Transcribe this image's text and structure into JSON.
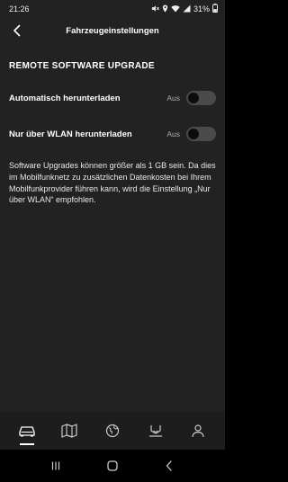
{
  "status_bar": {
    "time": "21:26",
    "battery": "31%",
    "icons": [
      "mute-icon",
      "location-icon",
      "wifi-icon",
      "signal-icon",
      "battery-icon"
    ]
  },
  "header": {
    "title": "Fahrzeugeinstellungen",
    "back_icon": "chevron-left-icon"
  },
  "section": {
    "title": "REMOTE SOFTWARE UPGRADE"
  },
  "settings": [
    {
      "label": "Automatisch herunterladen",
      "state": "Aus",
      "enabled": false
    },
    {
      "label": "Nur über WLAN herunterladen",
      "state": "Aus",
      "enabled": false
    }
  ],
  "info_text": "Software Upgrades können größer als 1 GB sein. Da dies im Mobilfunknetz zu zusätzlichen Datenkosten bei Ihrem Mobilfunkprovider führen kann, wird die Einstellung „Nur über WLAN“ empfohlen.",
  "bottom_nav": [
    {
      "icon": "car-icon",
      "active": true
    },
    {
      "icon": "map-icon",
      "active": false
    },
    {
      "icon": "globe-icon",
      "active": false
    },
    {
      "icon": "service-icon",
      "active": false
    },
    {
      "icon": "profile-icon",
      "active": false
    }
  ],
  "system_nav": [
    "recent-apps-icon",
    "home-icon",
    "back-icon"
  ],
  "colors": {
    "background": "#222222",
    "toggle_track": "#4a4a4a",
    "text": "#ffffff",
    "muted_text": "#aaaaaa"
  }
}
